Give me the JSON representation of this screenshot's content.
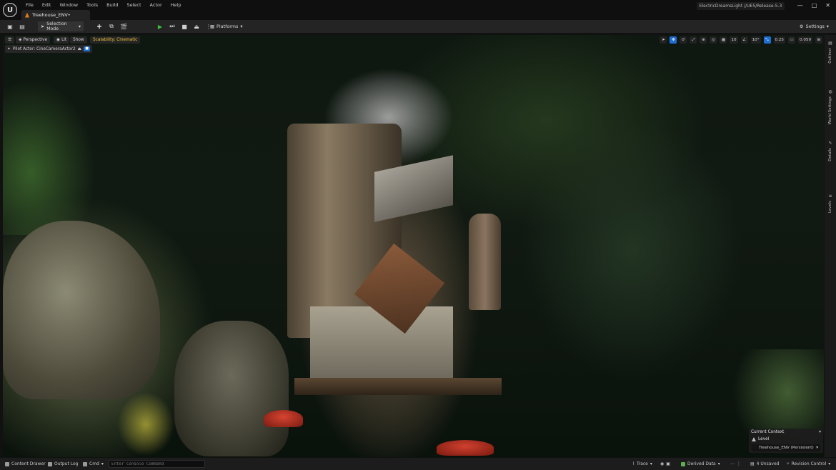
{
  "app": {
    "logo_letter": "U",
    "menu": [
      "File",
      "Edit",
      "Window",
      "Tools",
      "Build",
      "Select",
      "Actor",
      "Help"
    ],
    "doc_tab": "Treehouse_ENV•",
    "project": "ElectricDreamsLight //UE5/Release-5.3",
    "window_controls": [
      "—",
      "□",
      "✕"
    ]
  },
  "toolbar": {
    "selection_mode": "Selection Mode",
    "platforms": "Platforms",
    "settings": "Settings"
  },
  "viewport": {
    "perspective": "Perspective",
    "lit": "Lit",
    "show": "Show",
    "scalability": "Scalability: Cinematic",
    "pilot_actor": "Pilot Actor: CineCameraActor2",
    "grid_snap": "10",
    "rotation_snap": "10°",
    "scale_snap": "0.25",
    "camera_speed": "0.059"
  },
  "side_panels": [
    "Outliner",
    "World Settings",
    "Details",
    "Levels"
  ],
  "context": {
    "title": "Current Context",
    "level_label": "Level",
    "level_value": "Treehouse_ENV (Persistent)"
  },
  "statusbar": {
    "content_drawer": "Content Drawer",
    "output_log": "Output Log",
    "cmd": "Cmd",
    "console_placeholder": "Enter Console Command",
    "trace": "Trace",
    "derived_data": "Derived Data",
    "unsaved": "4 Unsaved",
    "revision_control": "Revision Control"
  },
  "colors": {
    "accent_blue": "#1f6ed4",
    "scalability_yellow": "#f0c23a",
    "play_green": "#3fbd3f",
    "tab_icon_orange": "#e07a1a"
  }
}
